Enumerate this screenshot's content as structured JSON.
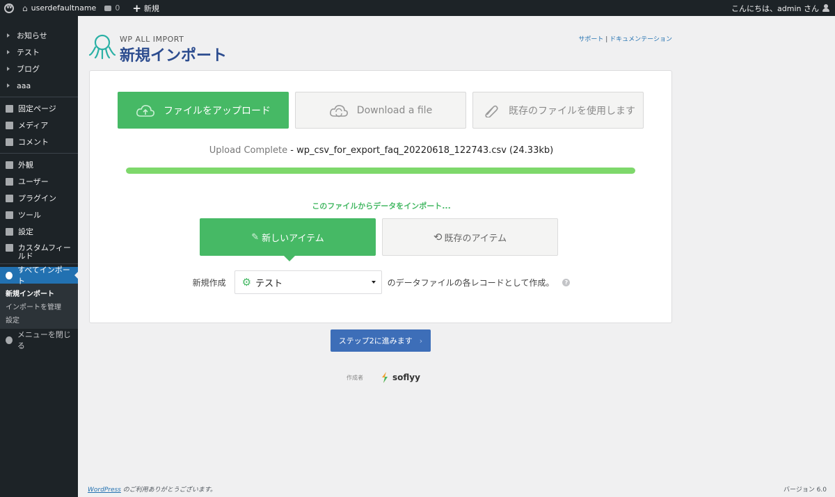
{
  "adminbar": {
    "site_name": "userdefaultname",
    "comment_count": "0",
    "new_label": "新規",
    "greeting": "こんにちは、admin さん"
  },
  "sidebar": {
    "items_top": [
      {
        "label": "お知らせ"
      },
      {
        "label": "テスト"
      },
      {
        "label": "ブログ"
      },
      {
        "label": "aaa"
      }
    ],
    "items_mid": [
      {
        "label": "固定ページ",
        "icon": "pages-icon"
      },
      {
        "label": "メディア",
        "icon": "media-icon"
      },
      {
        "label": "コメント",
        "icon": "comment-icon"
      }
    ],
    "items_admin": [
      {
        "label": "外観",
        "icon": "brush-icon"
      },
      {
        "label": "ユーザー",
        "icon": "users-icon"
      },
      {
        "label": "プラグイン",
        "icon": "plugins-icon"
      },
      {
        "label": "ツール",
        "icon": "wrench-icon"
      },
      {
        "label": "設定",
        "icon": "settings-icon"
      },
      {
        "label": "カスタムフィールド",
        "icon": "custom-fields-icon"
      }
    ],
    "active_item": "すべてインポート",
    "submenu": [
      {
        "label": "新規インポート",
        "current": true
      },
      {
        "label": "インポートを管理",
        "current": false
      },
      {
        "label": "設定",
        "current": false
      }
    ],
    "collapse_label": "メニューを閉じる"
  },
  "header": {
    "brand": "WP ALL IMPORT",
    "title": "新規インポート",
    "help_support": "サポート",
    "help_docs": "ドキュメンテーション"
  },
  "source_buttons": {
    "upload": "ファイルをアップロード",
    "download": "Download a file",
    "existing": "既存のファイルを使用します"
  },
  "upload": {
    "status": "Upload Complete",
    "separator": " - ",
    "filename": "wp_csv_for_export_faq_20220618_122743.csv (24.33kb)",
    "progress": 1.0
  },
  "import_type": {
    "prompt": "このファイルからデータをインポート...",
    "new_items": "新しいアイテム",
    "existing_items": "既存のアイテム"
  },
  "create_row": {
    "prefix": "新規作成",
    "selected": "テスト",
    "suffix": "のデータファイルの各レコードとして作成。",
    "help": "?"
  },
  "next_button": "ステップ2に進みます",
  "credit": {
    "made_by": "作成者",
    "company": "soflyy"
  },
  "footer": {
    "wp_link": "WordPress",
    "thanks": " のご利用ありがとうございます。",
    "version": "バージョン 6.0"
  },
  "colors": {
    "accent_green": "#46b965",
    "progress_green": "#7ed86b",
    "next_blue": "#3d6eb8",
    "admin_dark": "#1d2327",
    "menu_active": "#2271b1"
  }
}
